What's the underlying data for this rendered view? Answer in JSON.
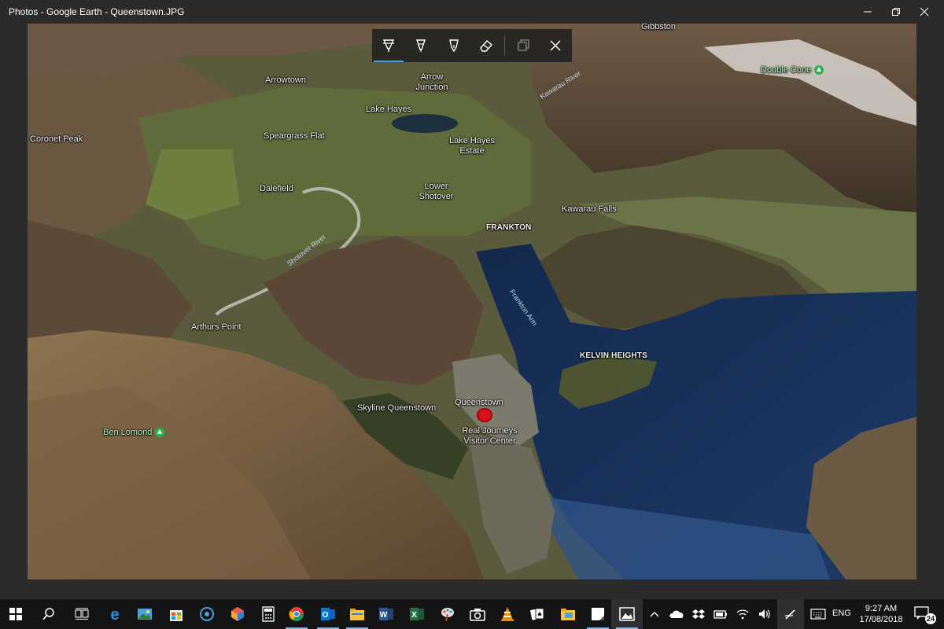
{
  "window": {
    "title": "Photos - Google Earth - Queenstown.JPG",
    "controls": {
      "minimize": "minimize-icon",
      "maximize": "restore-icon",
      "close": "close-icon"
    }
  },
  "ink_toolbar": {
    "tools": [
      {
        "name": "ballpoint-pen",
        "icon": "ballpoint-pen-icon",
        "active": true
      },
      {
        "name": "pencil",
        "icon": "pencil-icon",
        "active": false
      },
      {
        "name": "calligraphy-pen",
        "icon": "calligraphy-pen-icon",
        "active": false
      },
      {
        "name": "eraser",
        "icon": "eraser-icon",
        "active": false
      },
      {
        "name": "save-copy",
        "icon": "save-copy-icon",
        "active": false
      },
      {
        "name": "close",
        "icon": "close-icon",
        "active": false
      }
    ],
    "accent": "#4a9fe8"
  },
  "map": {
    "labels": {
      "gibbston": "Gibbston",
      "arrowtown": "Arrowtown",
      "arrow_junction_1": "Arrow",
      "arrow_junction_2": "Junction",
      "kawarau_river": "Kawarau River",
      "double_cone": "Double Cone",
      "lake_hayes": "Lake Hayes",
      "coronet_peak": "Coronet Peak",
      "speargrass_flat": "Speargrass Flat",
      "lake_hayes_estate_1": "Lake Hayes",
      "lake_hayes_estate_2": "Estate",
      "dalefield": "Dalefield",
      "lower_shotover_1": "Lower",
      "lower_shotover_2": "Shotover",
      "kawarau_falls": "Kawarau Falls",
      "frankton": "FRANKTON",
      "shotover_river": "Shotover River",
      "frankton_arm": "Frankton Arm",
      "arthurs_point": "Arthurs Point",
      "kelvin_heights": "KELVIN HEIGHTS",
      "skyline": "Skyline Queenstown",
      "queenstown": "Queenstown",
      "real_journeys_1": "Real Journeys",
      "real_journeys_2": "Visitor Center",
      "ben_lomond": "Ben Lomond"
    },
    "marker_color": "#d8121a"
  },
  "taskbar": {
    "apps": [
      "windows-start-icon",
      "search-icon",
      "task-view-icon",
      "edge-icon",
      "photos-gallery-icon",
      "store-icon",
      "dialer-icon",
      "3d-viewer-icon",
      "calculator-icon",
      "chrome-icon",
      "outlook-icon",
      "file-explorer-icon",
      "word-icon",
      "excel-icon",
      "paint-icon",
      "camera-icon",
      "vlc-icon",
      "solitaire-icon",
      "folder-photos-icon",
      "sticky-notes-icon",
      "photos-icon"
    ],
    "tray": {
      "icons": [
        "chevron-up-icon",
        "onedrive-icon",
        "dropbox-icon",
        "power-icon",
        "wifi-icon",
        "volume-icon",
        "pen-workspace-icon",
        "keyboard-icon"
      ],
      "language": "ENG",
      "time": "9:27 AM",
      "date": "17/08/2018",
      "notification_count": "24"
    }
  }
}
